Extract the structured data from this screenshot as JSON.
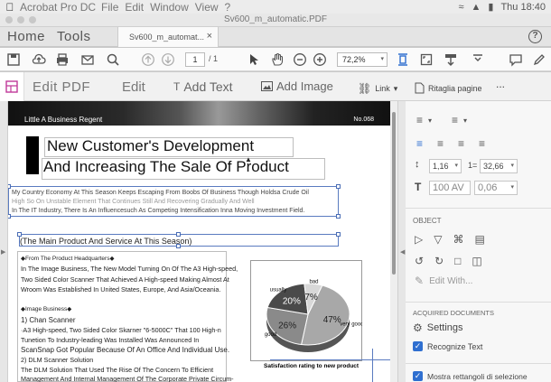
{
  "menubar": {
    "app_name": "Acrobat Pro DC",
    "menus": [
      "File",
      "Edit",
      "Window",
      "View",
      "?"
    ],
    "clock": "Thu 18:40"
  },
  "window": {
    "title": "Sv600_m_automatic.PDF"
  },
  "tabs": {
    "home": "Home",
    "tools": "Tools",
    "document_tab": "Sv600_m_automat...",
    "help": "?"
  },
  "toolbar": {
    "page_current": "1",
    "page_total": "/ 1",
    "zoom": "72,2%"
  },
  "edit_toolbar": {
    "title": "Edit PDF",
    "edit_label": "Edit",
    "add_text": "Add Text",
    "add_image": "Add Image",
    "link": "Link",
    "crop_pages": "Ritaglia pagine",
    "more": "..."
  },
  "document": {
    "banner_left": "Little A Business Regent",
    "banner_right": "No.068",
    "heading1": "New Customer's Development",
    "heading2": "And Increasing The Sale Of Product",
    "intro_lines": [
      "My Country Economy At This Season Keeps Escaping From Boobs Of Business Though Holdsa Crude Oil",
      "High So On Unstable Element That Continues Still And Recovering Gradually And Well",
      "In The IT Industry, There Is An Influencesuch As Competing Intensification Inna Moving Investment Field."
    ],
    "subheading": "(The Main Product And Service At This Season)",
    "col_lines": [
      "◆From The Product Headquarters◆",
      "In The Image Business, The New Model Turning On Of The A3 High-speed,",
      "Two Sided Color Scanner That Achieved A High-speed Making Almost At",
      "Wroom Was Established In United States, Europe, And Asia/Oceania.",
      "",
      "◆Image Business◆",
      "1) Chan Scanner",
      "·A3 High-speed, Two Sided Color Skarner \"6-5000C\" That 100 High-n",
      "Tunetion To Industry-leading Was Installed Was Announced In",
      "ScanSnap Got Popular Because Of An Office And Individual Use.",
      "2) DLM Scanner Solution",
      "The DLM Solution That Used The Rise Of The Concern To Efficient",
      "Management And Internal Management Of The Corporate Private Circum-"
    ],
    "chart_caption": "Satisfaction rating to new product",
    "chart_labels": {
      "usually": "usually",
      "bad": "bad",
      "very_good": "very good",
      "good": "good"
    },
    "chart_values": {
      "usually": "20%",
      "bad": "7%",
      "very_good": "47%",
      "good": "26%"
    }
  },
  "panel": {
    "line_spacing": "1,16",
    "paragraph_spacing": "32,66",
    "char_scale": "100 AV",
    "char_spacing": "0,06",
    "object_header": "OBJECT",
    "edit_with": "Edit With...",
    "scanned_header": "ACQUIRED DOCUMENTS",
    "settings": "Settings",
    "recognize_text": "Recognize Text",
    "show_boxes": "Mostra rettangoli di selezione"
  },
  "colors": {
    "accent": "#2f6fd0",
    "selection": "#5a7bc0",
    "chart_dark": "#4a4a4a",
    "chart_light": "#b0b0b0"
  },
  "chart_data": {
    "type": "pie",
    "title": "Satisfaction rating to new product",
    "categories": [
      "very good",
      "good",
      "usually",
      "bad"
    ],
    "values": [
      47,
      26,
      20,
      7
    ]
  }
}
